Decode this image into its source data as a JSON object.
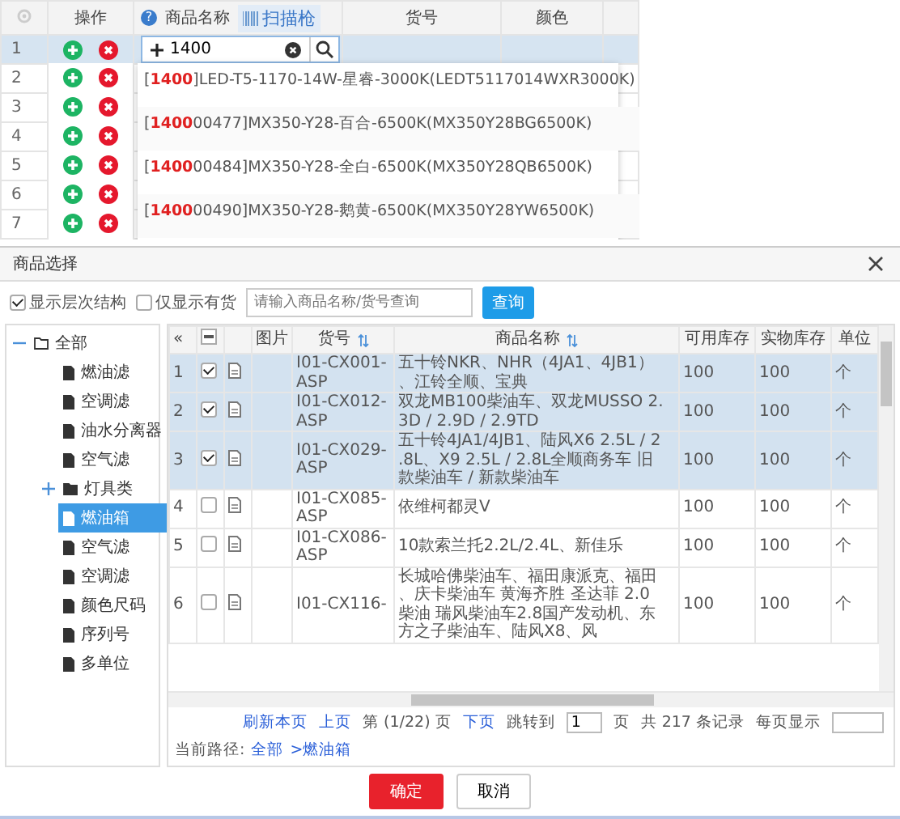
{
  "grid": {
    "columns": [
      {
        "label": "操作"
      },
      {
        "label": "商品名称"
      },
      {
        "label": "货号"
      },
      {
        "label": "颜色"
      }
    ],
    "help": "?",
    "scanner_button": "扫描枪",
    "rows": [
      {
        "index": "1",
        "selected": true
      },
      {
        "index": "2",
        "selected": false
      },
      {
        "index": "3",
        "selected": false
      },
      {
        "index": "4",
        "selected": false
      },
      {
        "index": "5",
        "selected": false
      },
      {
        "index": "6",
        "selected": false
      },
      {
        "index": "7",
        "selected": false
      }
    ],
    "editor": {
      "value": "1400"
    },
    "suggestions": [
      "[**1400**]LED-T5-1170-14W-星睿-3000K(LEDT5117014WXR3000K)",
      "[**1400**00477]MX350-Y28-百合-6500K(MX350Y28BG6500K)",
      "[**1400**00484]MX350-Y28-全白-6500K(MX350Y28QB6500K)",
      "[**1400**00490]MX350-Y28-鹅黄-6500K(MX350Y28YW6500K)"
    ]
  },
  "dialog": {
    "title": "商品选择",
    "options": [
      {
        "label": "显示层次结构",
        "checked": true
      },
      {
        "label": "仅显示有货",
        "checked": false
      }
    ],
    "search": {
      "placeholder": "请输入商品名称/货号查询"
    },
    "search_button": "查询",
    "tree": [
      {
        "label": "全部",
        "kind": "folder",
        "expanded": true,
        "selected": false,
        "children": [
          {
            "label": "燃油滤",
            "kind": "file",
            "selected": false
          },
          {
            "label": "空调滤",
            "kind": "file",
            "selected": false
          },
          {
            "label": "油水分离器",
            "kind": "file",
            "selected": false
          },
          {
            "label": "空气滤",
            "kind": "file",
            "selected": false
          },
          {
            "label": "灯具类",
            "kind": "folder",
            "expanded": false,
            "selected": false
          },
          {
            "label": "燃油箱",
            "kind": "file",
            "selected": true
          },
          {
            "label": "空气滤",
            "kind": "file",
            "selected": false
          },
          {
            "label": "空调滤",
            "kind": "file",
            "selected": false
          },
          {
            "label": "颜色尺码",
            "kind": "file",
            "selected": false
          },
          {
            "label": "序列号",
            "kind": "file",
            "selected": false
          },
          {
            "label": "多单位",
            "kind": "file",
            "selected": false
          }
        ]
      }
    ],
    "table": {
      "collapse": "«",
      "select_all": {
        "partial": true
      },
      "columns": [
        {
          "label": "图片",
          "sortable": false
        },
        {
          "label": "货号",
          "sortable": true
        },
        {
          "label": "商品名称",
          "sortable": true
        },
        {
          "label": "可用库存",
          "sortable": false
        },
        {
          "label": "实物库存",
          "sortable": false
        },
        {
          "label": "单位",
          "sortable": false
        }
      ],
      "rows": [
        {
          "index": "1",
          "checked": true,
          "code": "I01-CX001-ASP",
          "name": "五十铃NKR、NHR（4JA1、4JB1）、江铃全顺、宝典",
          "available": "100",
          "actual": "100",
          "unit": "个"
        },
        {
          "index": "2",
          "checked": true,
          "code": "I01-CX012-ASP",
          "name": "双龙MB100柴油车、双龙MUSSO 2.3D / 2.9D / 2.9TD",
          "available": "100",
          "actual": "100",
          "unit": "个"
        },
        {
          "index": "3",
          "checked": true,
          "code": "I01-CX029-ASP",
          "name": "五十铃4JA1/4JB1、陆风X6 2.5L / 2.8L、X9 2.5L / 2.8L全顺商务车 旧款柴油车 / 新款柴油车",
          "available": "100",
          "actual": "100",
          "unit": "个"
        },
        {
          "index": "4",
          "checked": false,
          "code": "I01-CX085-ASP",
          "name": "依维柯都灵V",
          "available": "100",
          "actual": "100",
          "unit": "个"
        },
        {
          "index": "5",
          "checked": false,
          "code": "I01-CX086-ASP",
          "name": "10款索兰托2.2L/2.4L、新佳乐",
          "available": "100",
          "actual": "100",
          "unit": "个"
        },
        {
          "index": "6",
          "checked": false,
          "code": "I01-CX116-",
          "name": "长城哈佛柴油车、福田康派克、福田、庆卡柴油车 黄海齐胜 圣达菲 2.0柴油 瑞风柴油车2.8国产发动机、东方之子柴油车、陆风X8、风",
          "available": "100",
          "actual": "100",
          "unit": "个"
        }
      ]
    },
    "pager": {
      "refresh": "刷新本页",
      "prev": "上页",
      "page_info": "第 (1/22) 页",
      "next": "下页",
      "jump_label": "跳转到",
      "jump_value": "1",
      "jump_unit": "页",
      "total": "共 217 条记录",
      "per_page_label": "每页显示"
    },
    "path": {
      "label": "当前路径:",
      "links": [
        "全部",
        ">燃油箱"
      ]
    },
    "buttons": [
      {
        "label": "确定",
        "kind": "primary"
      },
      {
        "label": "取消",
        "kind": "default"
      }
    ]
  }
}
